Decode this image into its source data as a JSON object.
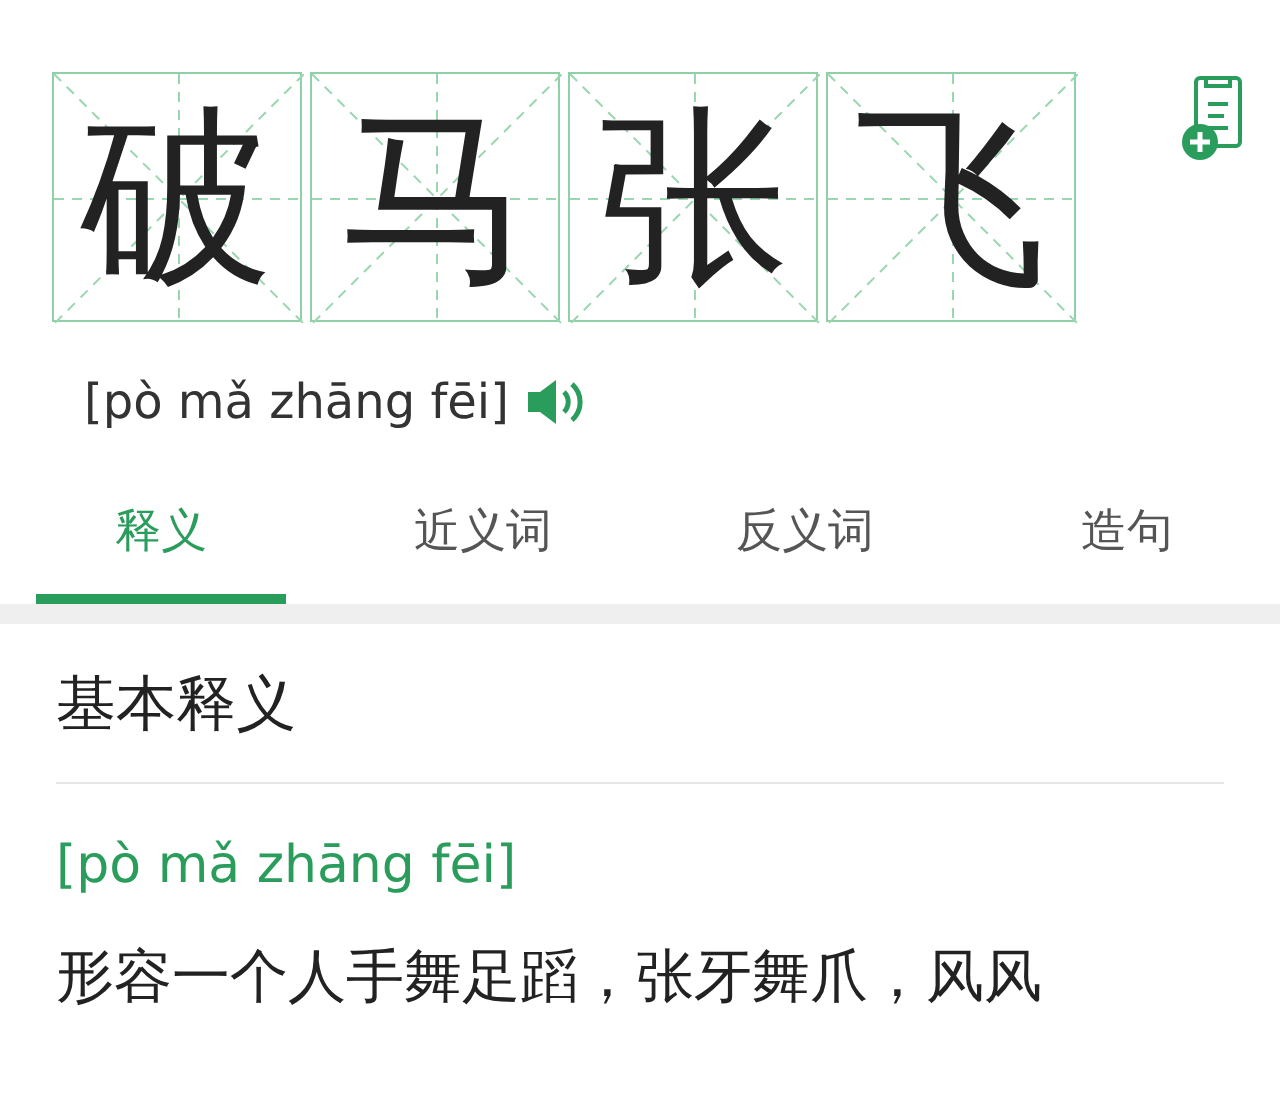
{
  "word": {
    "characters": [
      "破",
      "马",
      "张",
      "飞"
    ]
  },
  "pinyin": "[pò mǎ zhāng fēi]",
  "tabs": [
    {
      "label": "释义",
      "selected": true
    },
    {
      "label": "近义词",
      "selected": false
    },
    {
      "label": "反义词",
      "selected": false
    },
    {
      "label": "造句",
      "selected": false
    }
  ],
  "section": {
    "title": "基本释义",
    "pinyin": "[pò mǎ zhāng fēi]",
    "definition": "形容一个人手舞足蹈，张牙舞爪，风风"
  }
}
